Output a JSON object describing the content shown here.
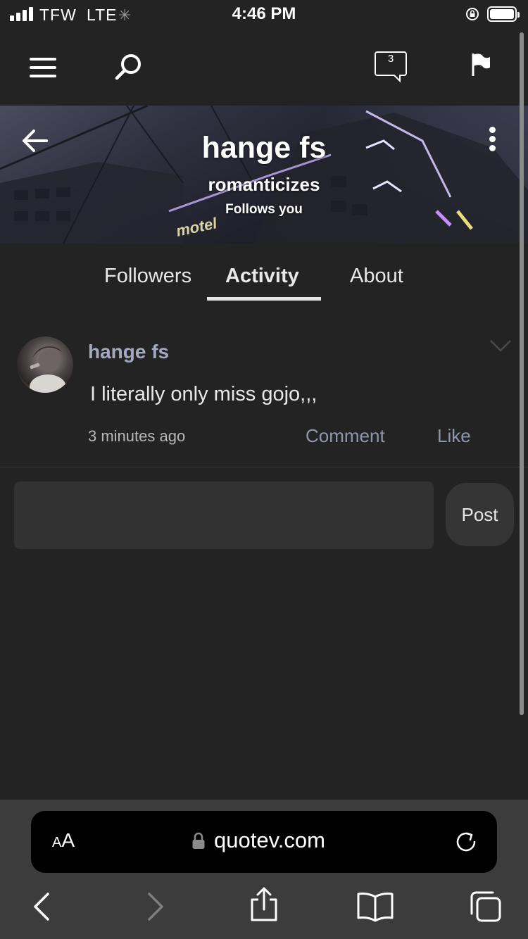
{
  "status_bar": {
    "carrier": "TFW",
    "network": "LTE",
    "time": "4:46 PM"
  },
  "nav": {
    "notification_count": "3"
  },
  "profile": {
    "name": "hange fs",
    "tagline": "romanticizes",
    "follows_badge": "Follows you"
  },
  "tabs": [
    {
      "label": "Followers",
      "active": false
    },
    {
      "label": "Activity",
      "active": true
    },
    {
      "label": "About",
      "active": false
    }
  ],
  "activity": {
    "author": "hange fs",
    "text": "I literally only miss gojo,,,",
    "time": "3 minutes ago",
    "comment_label": "Comment",
    "like_label": "Like"
  },
  "composer": {
    "value": "",
    "post_label": "Post"
  },
  "browser": {
    "text_size_label_small": "A",
    "text_size_label_large": "A",
    "url": "quotev.com"
  },
  "colors": {
    "background": "#232323",
    "link_accent": "#8e95ad",
    "author_accent": "#a3a9bf"
  }
}
